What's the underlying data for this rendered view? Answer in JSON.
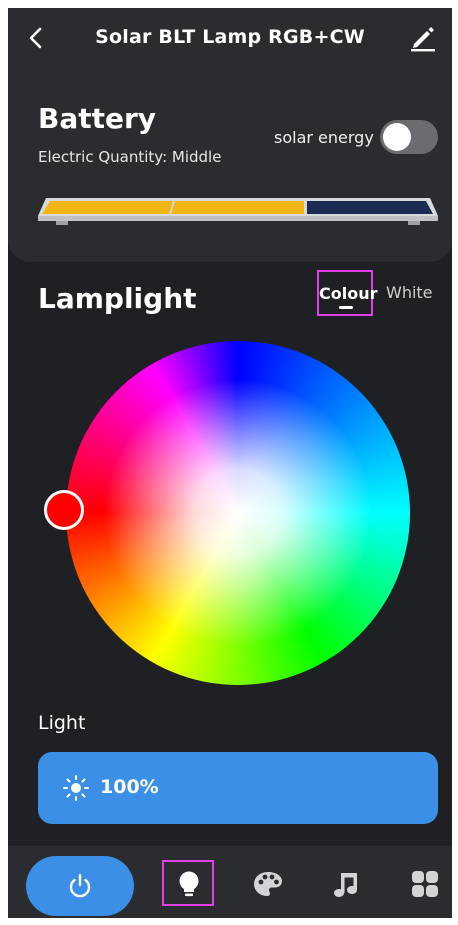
{
  "header": {
    "title": "Solar BLT Lamp RGB+CW"
  },
  "battery": {
    "title": "Battery",
    "subtitle": "Electric Quantity: Middle",
    "solar_label": "solar energy",
    "solar_enabled": false,
    "charge_fraction": 0.67,
    "colors": {
      "charged": "#f2b516",
      "empty": "#1c2b52",
      "frame": "#d7d9dc"
    }
  },
  "lamplight": {
    "title": "Lamplight",
    "tabs": [
      {
        "label": "Colour",
        "active": true
      },
      {
        "label": "White",
        "active": false
      }
    ],
    "selected_color": "#ff0000"
  },
  "light": {
    "label": "Light",
    "value": "100%",
    "accent": "#3b8fe6"
  },
  "nav": {
    "items": [
      "power-icon",
      "bulb-icon",
      "palette-icon",
      "music-icon",
      "grid-icon"
    ],
    "active": "bulb-icon"
  }
}
